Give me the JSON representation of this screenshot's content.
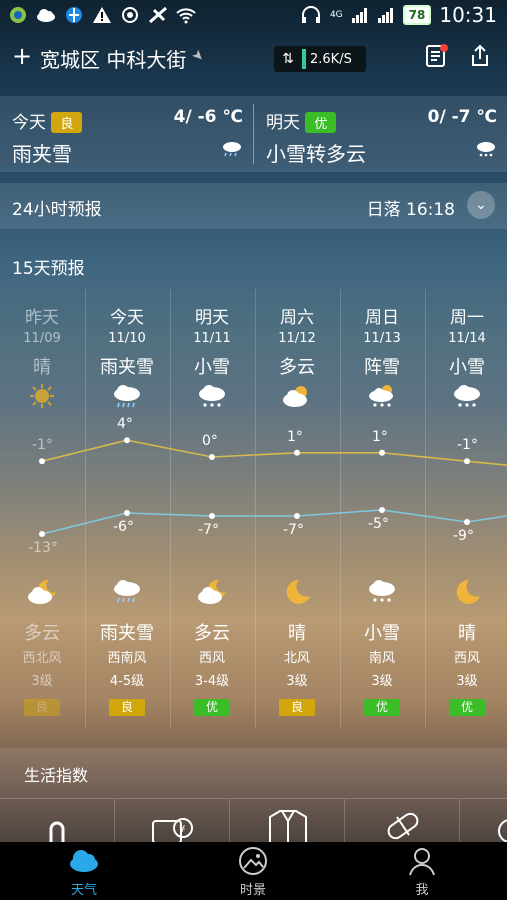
{
  "status_bar": {
    "battery": "78",
    "time": "10:31",
    "network": "4G"
  },
  "top_bar": {
    "location": "宽城区 中科大街",
    "net_speed": "2.6K/S"
  },
  "today": {
    "label": "今天",
    "aqi": "良",
    "temp": "4/ -6 ℃",
    "desc": "雨夹雪",
    "icon": "sleet-icon"
  },
  "tomorrow": {
    "label": "明天",
    "aqi": "优",
    "temp": "0/ -7 ℃",
    "desc": "小雪转多云",
    "icon": "snow-icon"
  },
  "hourly": {
    "title": "24小时预报",
    "sunset": "日落 16:18"
  },
  "forecast_title": "15天预报",
  "forecast": [
    {
      "day": "昨天",
      "date": "11/09",
      "weather_day": "晴",
      "icon_day": "sun-icon",
      "high": "-1°",
      "low": "-13°",
      "icon_night": "cloudy-night-icon",
      "weather_night": "多云",
      "wind_dir": "西北风",
      "wind_level": "3级",
      "aqi": "良",
      "aqi_color": "#d2a70d"
    },
    {
      "day": "今天",
      "date": "11/10",
      "weather_day": "雨夹雪",
      "icon_day": "sleet-icon",
      "high": "4°",
      "low": "-6°",
      "icon_night": "sleet-icon",
      "weather_night": "雨夹雪",
      "wind_dir": "西南风",
      "wind_level": "4-5级",
      "aqi": "良",
      "aqi_color": "#d2a70d"
    },
    {
      "day": "明天",
      "date": "11/11",
      "weather_day": "小雪",
      "icon_day": "snow-icon",
      "high": "0°",
      "low": "-7°",
      "icon_night": "cloudy-night-icon",
      "weather_night": "多云",
      "wind_dir": "西风",
      "wind_level": "3-4级",
      "aqi": "优",
      "aqi_color": "#3bbd28"
    },
    {
      "day": "周六",
      "date": "11/12",
      "weather_day": "多云",
      "icon_day": "partly-cloudy-icon",
      "high": "1°",
      "low": "-7°",
      "icon_night": "moon-icon",
      "weather_night": "晴",
      "wind_dir": "北风",
      "wind_level": "3级",
      "aqi": "良",
      "aqi_color": "#d2a70d"
    },
    {
      "day": "周日",
      "date": "11/13",
      "weather_day": "阵雪",
      "icon_day": "snow-shower-icon",
      "high": "1°",
      "low": "-5°",
      "icon_night": "snow-icon",
      "weather_night": "小雪",
      "wind_dir": "南风",
      "wind_level": "3级",
      "aqi": "优",
      "aqi_color": "#3bbd28"
    },
    {
      "day": "周一",
      "date": "11/14",
      "weather_day": "小雪",
      "icon_day": "snow-icon",
      "high": "-1°",
      "low": "-9°",
      "icon_night": "moon-icon",
      "weather_night": "晴",
      "wind_dir": "西风",
      "wind_level": "3级",
      "aqi": "优",
      "aqi_color": "#3bbd28"
    }
  ],
  "life_title": "生活指数",
  "bottom_nav": [
    {
      "label": "天气",
      "icon": "weather-cloud-icon",
      "active": true
    },
    {
      "label": "时景",
      "icon": "photo-scene-icon",
      "active": false
    },
    {
      "label": "我",
      "icon": "profile-icon",
      "active": false
    }
  ],
  "colors": {
    "accent": "#2aa8e8",
    "high_line": "#d8b84a",
    "low_line": "#7ec8e0"
  }
}
